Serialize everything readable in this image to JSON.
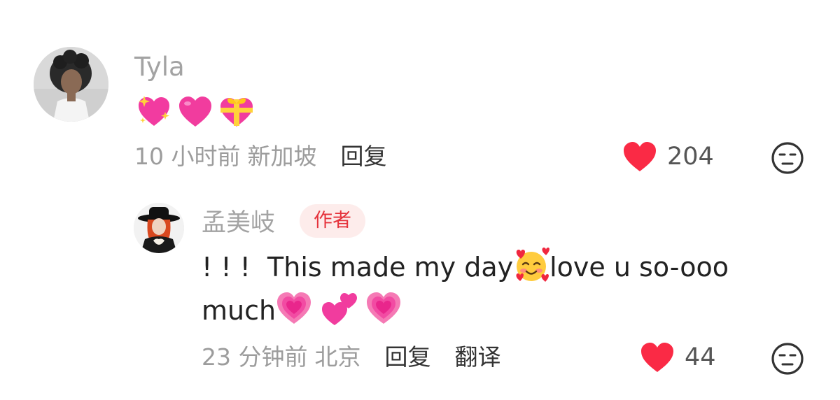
{
  "comments": [
    {
      "username": "Tyla",
      "emojis": [
        "sparkling-heart",
        "pink-heart",
        "heart-with-ribbon"
      ],
      "time": "10 小时前",
      "location": "新加坡",
      "reply_label": "回复",
      "like_count": "204"
    },
    {
      "username": "孟美岐",
      "badge": "作者",
      "text_part1": "! ! !  This made my day",
      "text_part2": "love u so-ooo",
      "text_part3": "much",
      "time": "23 分钟前",
      "location": "北京",
      "reply_label": "回复",
      "translate_label": "翻译",
      "like_count": "44"
    }
  ],
  "colors": {
    "like_heart": "#fa2a45",
    "badge_bg": "#fdeceb",
    "badge_text": "#e5323b",
    "meta_text": "#9c9c9c"
  }
}
